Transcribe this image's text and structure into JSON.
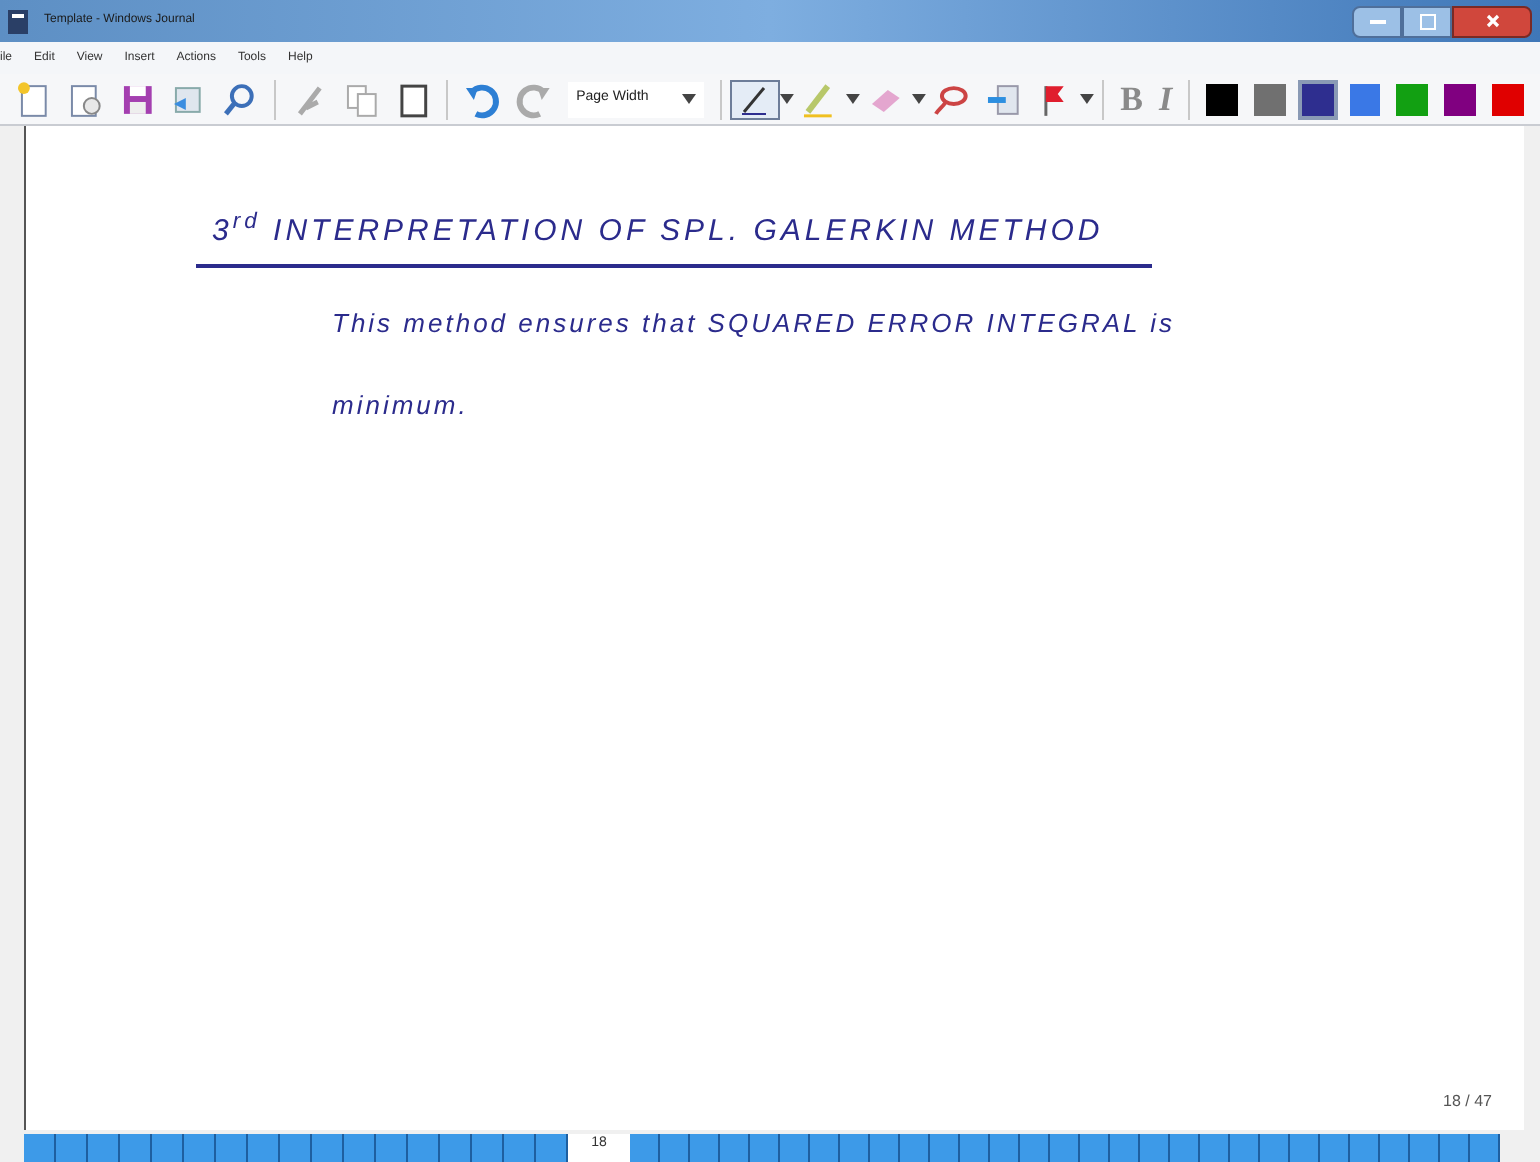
{
  "window": {
    "title": "Template - Windows Journal"
  },
  "menu": [
    "ile",
    "Edit",
    "View",
    "Insert",
    "Actions",
    "Tools",
    "Help"
  ],
  "toolbar": {
    "zoom": "Page Width",
    "bold": "B",
    "italic": "I",
    "swatches": [
      {
        "color": "#000000",
        "selected": false
      },
      {
        "color": "#707070",
        "selected": false
      },
      {
        "color": "#2e2e8f",
        "selected": true
      },
      {
        "color": "#3a78e6",
        "selected": false
      },
      {
        "color": "#12a012",
        "selected": false
      },
      {
        "color": "#800080",
        "selected": false
      },
      {
        "color": "#e00000",
        "selected": false
      }
    ]
  },
  "note": {
    "heading": "3$^{rd}$ INTERPRETATION OF SPL. GALERKIN METHOD",
    "lines": [
      "This method ensures that SQUARED ERROR INTEGRAL is",
      "minimum."
    ]
  },
  "page_indicator": "18 / 47",
  "page_strip": {
    "current": "18"
  }
}
